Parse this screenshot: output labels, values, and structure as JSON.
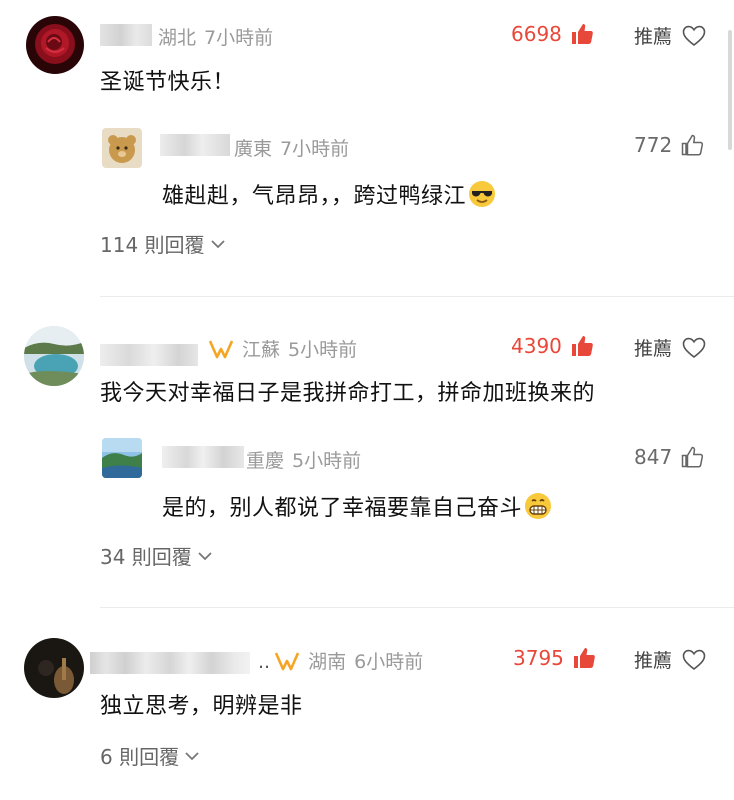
{
  "colors": {
    "hot_like": "#e8483a",
    "meta": "#9a9a9a",
    "vip_badge": "#f5a524"
  },
  "threads": [
    {
      "comment": {
        "location": "湖北",
        "time": "7小時前",
        "text": "圣诞节快乐！",
        "likes": "6698",
        "recommend": "推薦"
      },
      "reply": {
        "location": "廣東",
        "time": "7小時前",
        "text": "雄赳赳，气昂昂，，跨过鸭绿江",
        "emoji": "sunglasses-emoji",
        "likes": "772"
      },
      "reply_count": "114 則回覆"
    },
    {
      "comment": {
        "location": "江蘇",
        "time": "5小時前",
        "text": "我今天对幸福日子是我拼命打工，拼命加班换来的",
        "likes": "4390",
        "recommend": "推薦"
      },
      "reply": {
        "location": "重慶",
        "time": "5小時前",
        "text": "是的，别人都说了幸福要靠自己奋斗",
        "emoji": "grin-emoji",
        "likes": "847"
      },
      "reply_count": "34 則回覆"
    },
    {
      "comment": {
        "name_suffix": "..",
        "location": "湖南",
        "time": "6小時前",
        "text": "独立思考，明辨是非",
        "likes": "3795",
        "recommend": "推薦"
      },
      "reply_count": "6 則回覆"
    }
  ]
}
